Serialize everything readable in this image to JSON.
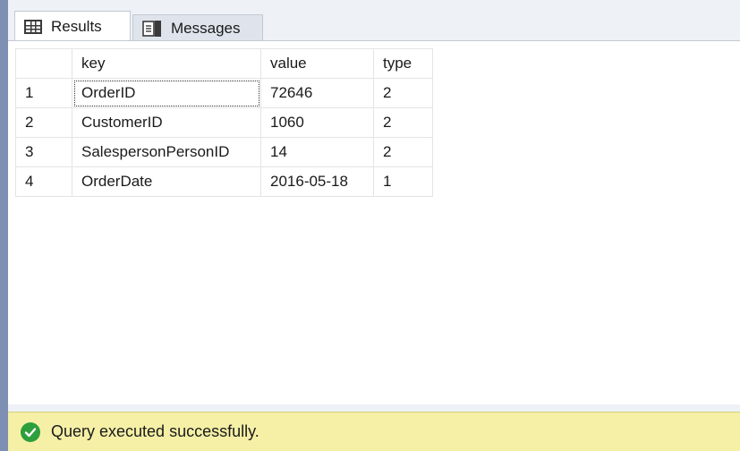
{
  "tabs": [
    {
      "label": "Results",
      "icon": "grid-icon",
      "active": true
    },
    {
      "label": "Messages",
      "icon": "messages-icon",
      "active": false
    }
  ],
  "results": {
    "columns": [
      "key",
      "value",
      "type"
    ],
    "rows": [
      {
        "num": "1",
        "key": "OrderID",
        "value": "72646",
        "type": "2"
      },
      {
        "num": "2",
        "key": "CustomerID",
        "value": "1060",
        "type": "2"
      },
      {
        "num": "3",
        "key": "SalespersonPersonID",
        "value": "14",
        "type": "2"
      },
      {
        "num": "4",
        "key": "OrderDate",
        "value": "2016-05-18",
        "type": "1"
      }
    ]
  },
  "status": {
    "text": "Query executed successfully.",
    "icon": "success-check-icon",
    "color": "#2d9f3c",
    "background": "#f5f0a6"
  }
}
